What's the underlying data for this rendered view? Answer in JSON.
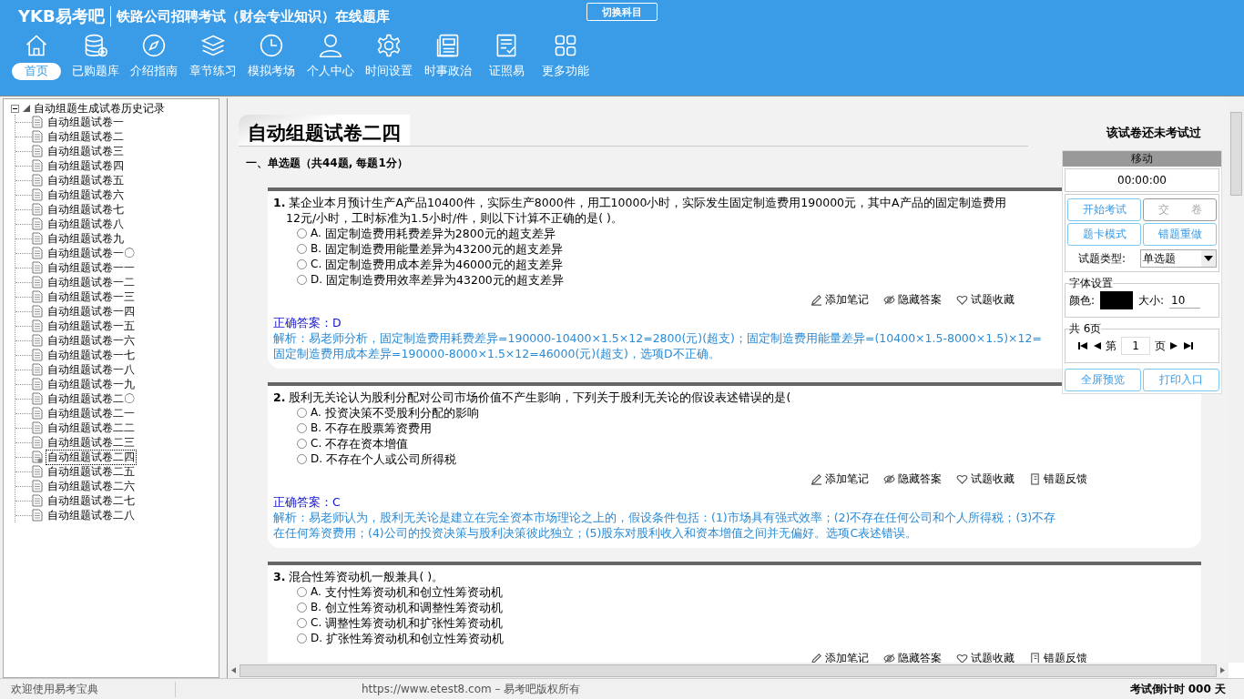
{
  "header": {
    "logo": "YKB易考吧",
    "title": "铁路公司招聘考试（财会专业知识）在线题库",
    "switch_button": "切换科目"
  },
  "nav": [
    {
      "label": "首页",
      "kind": "home",
      "selected": true
    },
    {
      "label": "已购题库",
      "kind": "database",
      "selected": false
    },
    {
      "label": "介绍指南",
      "kind": "compass",
      "selected": false
    },
    {
      "label": "章节练习",
      "kind": "layers",
      "selected": false
    },
    {
      "label": "模拟考场",
      "kind": "clock",
      "selected": false
    },
    {
      "label": "个人中心",
      "kind": "user",
      "selected": false
    },
    {
      "label": "时间设置",
      "kind": "gear",
      "selected": false
    },
    {
      "label": "时事政治",
      "kind": "news",
      "selected": false
    },
    {
      "label": "证照易",
      "kind": "checklist",
      "selected": false
    },
    {
      "label": "更多功能",
      "kind": "grid",
      "selected": false
    }
  ],
  "tree": {
    "label": "自动组题生成试卷历史记录",
    "expanded": true,
    "children": [
      {
        "label": "自动组题试卷一",
        "selected": false
      },
      {
        "label": "自动组题试卷二",
        "selected": false
      },
      {
        "label": "自动组题试卷三",
        "selected": false
      },
      {
        "label": "自动组题试卷四",
        "selected": false
      },
      {
        "label": "自动组题试卷五",
        "selected": false
      },
      {
        "label": "自动组题试卷六",
        "selected": false
      },
      {
        "label": "自动组题试卷七",
        "selected": false
      },
      {
        "label": "自动组题试卷八",
        "selected": false
      },
      {
        "label": "自动组题试卷九",
        "selected": false
      },
      {
        "label": "自动组题试卷一〇",
        "selected": false
      },
      {
        "label": "自动组题试卷一一",
        "selected": false
      },
      {
        "label": "自动组题试卷一二",
        "selected": false
      },
      {
        "label": "自动组题试卷一三",
        "selected": false
      },
      {
        "label": "自动组题试卷一四",
        "selected": false
      },
      {
        "label": "自动组题试卷一五",
        "selected": false
      },
      {
        "label": "自动组题试卷一六",
        "selected": false
      },
      {
        "label": "自动组题试卷一七",
        "selected": false
      },
      {
        "label": "自动组题试卷一八",
        "selected": false
      },
      {
        "label": "自动组题试卷一九",
        "selected": false
      },
      {
        "label": "自动组题试卷二〇",
        "selected": false
      },
      {
        "label": "自动组题试卷二一",
        "selected": false
      },
      {
        "label": "自动组题试卷二二",
        "selected": false
      },
      {
        "label": "自动组题试卷二三",
        "selected": false
      },
      {
        "label": "自动组题试卷二四",
        "selected": true
      },
      {
        "label": "自动组题试卷二五",
        "selected": false
      },
      {
        "label": "自动组题试卷二六",
        "selected": false
      },
      {
        "label": "自动组题试卷二七",
        "selected": false
      },
      {
        "label": "自动组题试卷二八",
        "selected": false
      }
    ]
  },
  "paper": {
    "title": "自动组题试卷二四",
    "status": "该试卷还未考试过",
    "section": "一、单选题（共44题, 每题1分）"
  },
  "questions": [
    {
      "number": "1.",
      "lines": [
        "某企业本月预计生产A产品10400件，实际生产8000件，用工10000小时，实际发生固定制造费用190000元，其中A产品的固定制造费用",
        "12元/小时，工时标准为1.5小时/件，则以下计算不正确的是( )。"
      ],
      "options": [
        {
          "letter": "A.",
          "text": "固定制造费用耗费差异为2800元的超支差异",
          "selected": false
        },
        {
          "letter": "B.",
          "text": "固定制造费用能量差异为43200元的超支差异",
          "selected": false
        },
        {
          "letter": "C.",
          "text": "固定制造费用成本差异为46000元的超支差异",
          "selected": false
        },
        {
          "letter": "D.",
          "text": "固定制造费用效率差异为43200元的超支差异",
          "selected": false
        }
      ],
      "actions": [
        {
          "label": "添加笔记",
          "kind": "pencil"
        },
        {
          "label": "隐藏答案",
          "kind": "eye"
        },
        {
          "label": "试题收藏",
          "kind": "heart"
        }
      ],
      "answer": "正确答案：D",
      "analysis": [
        "解析：易老师分析，固定制造费用耗费差异=190000-10400×1.5×12=2800(元)(超支)；固定制造费用能量差异=(10400×1.5-8000×1.5)×12=",
        "固定制造费用成本差异=190000-8000×1.5×12=46000(元)(超支)，选项D不正确。"
      ]
    },
    {
      "number": "2.",
      "lines": [
        "股利无关论认为股利分配对公司市场价值不产生影响，下列关于股利无关论的假设表述错误的是("
      ],
      "options": [
        {
          "letter": "A.",
          "text": "投资决策不受股利分配的影响",
          "selected": false
        },
        {
          "letter": "B.",
          "text": "不存在股票筹资费用",
          "selected": false
        },
        {
          "letter": "C.",
          "text": "不存在资本增值",
          "selected": false
        },
        {
          "letter": "D.",
          "text": "不存在个人或公司所得税",
          "selected": false
        }
      ],
      "actions": [
        {
          "label": "添加笔记",
          "kind": "pencil"
        },
        {
          "label": "隐藏答案",
          "kind": "eye"
        },
        {
          "label": "试题收藏",
          "kind": "heart"
        },
        {
          "label": "错题反馈",
          "kind": "flag"
        }
      ],
      "answer": "正确答案：C",
      "analysis": [
        "解析：易老师认为，股利无关论是建立在完全资本市场理论之上的，假设条件包括：(1)市场具有强式效率；(2)不存在任何公司和个人所得税；(3)不存",
        "在任何筹资费用；(4)公司的投资决策与股利决策彼此独立；(5)股东对股利收入和资本增值之间并无偏好。选项C表述错误。"
      ]
    },
    {
      "number": "3.",
      "lines": [
        "混合性筹资动机一般兼具( )。"
      ],
      "options": [
        {
          "letter": "A.",
          "text": "支付性筹资动机和创立性筹资动机",
          "selected": false
        },
        {
          "letter": "B.",
          "text": "创立性筹资动机和调整性筹资动机",
          "selected": false
        },
        {
          "letter": "C.",
          "text": "调整性筹资动机和扩张性筹资动机",
          "selected": false
        },
        {
          "letter": "D.",
          "text": "扩张性筹资动机和创立性筹资动机",
          "selected": false
        }
      ],
      "actions": [
        {
          "label": "添加笔记",
          "kind": "pencil"
        },
        {
          "label": "隐藏答案",
          "kind": "eye"
        },
        {
          "label": "试题收藏",
          "kind": "heart"
        },
        {
          "label": "错题反馈",
          "kind": "flag"
        }
      ]
    }
  ],
  "panel": {
    "header": "移动",
    "timer": "00:00:00",
    "buttons": [
      {
        "label": "开始考试",
        "disabled": false
      },
      {
        "label": "交　　卷",
        "disabled": true
      },
      {
        "label": "题卡模式",
        "disabled": false
      },
      {
        "label": "错题重做",
        "disabled": false
      }
    ],
    "type_label": "试题类型:",
    "type_value": "单选题",
    "font_legend": "字体设置",
    "color_label": "颜色:",
    "color": "#000000",
    "size_label": "大小:",
    "size_value": "10",
    "pages_legend": "共 6页",
    "page_prefix": "第",
    "page_value": "1",
    "page_suffix": "页",
    "bottom_buttons": [
      {
        "label": "全屏预览",
        "disabled": false
      },
      {
        "label": "打印入口",
        "disabled": false
      }
    ]
  },
  "status_bar": {
    "welcome": "欢迎使用易考宝典",
    "copyright": "https://www.etest8.com – 易考吧版权所有",
    "countdown": "考试倒计时 000 天"
  }
}
